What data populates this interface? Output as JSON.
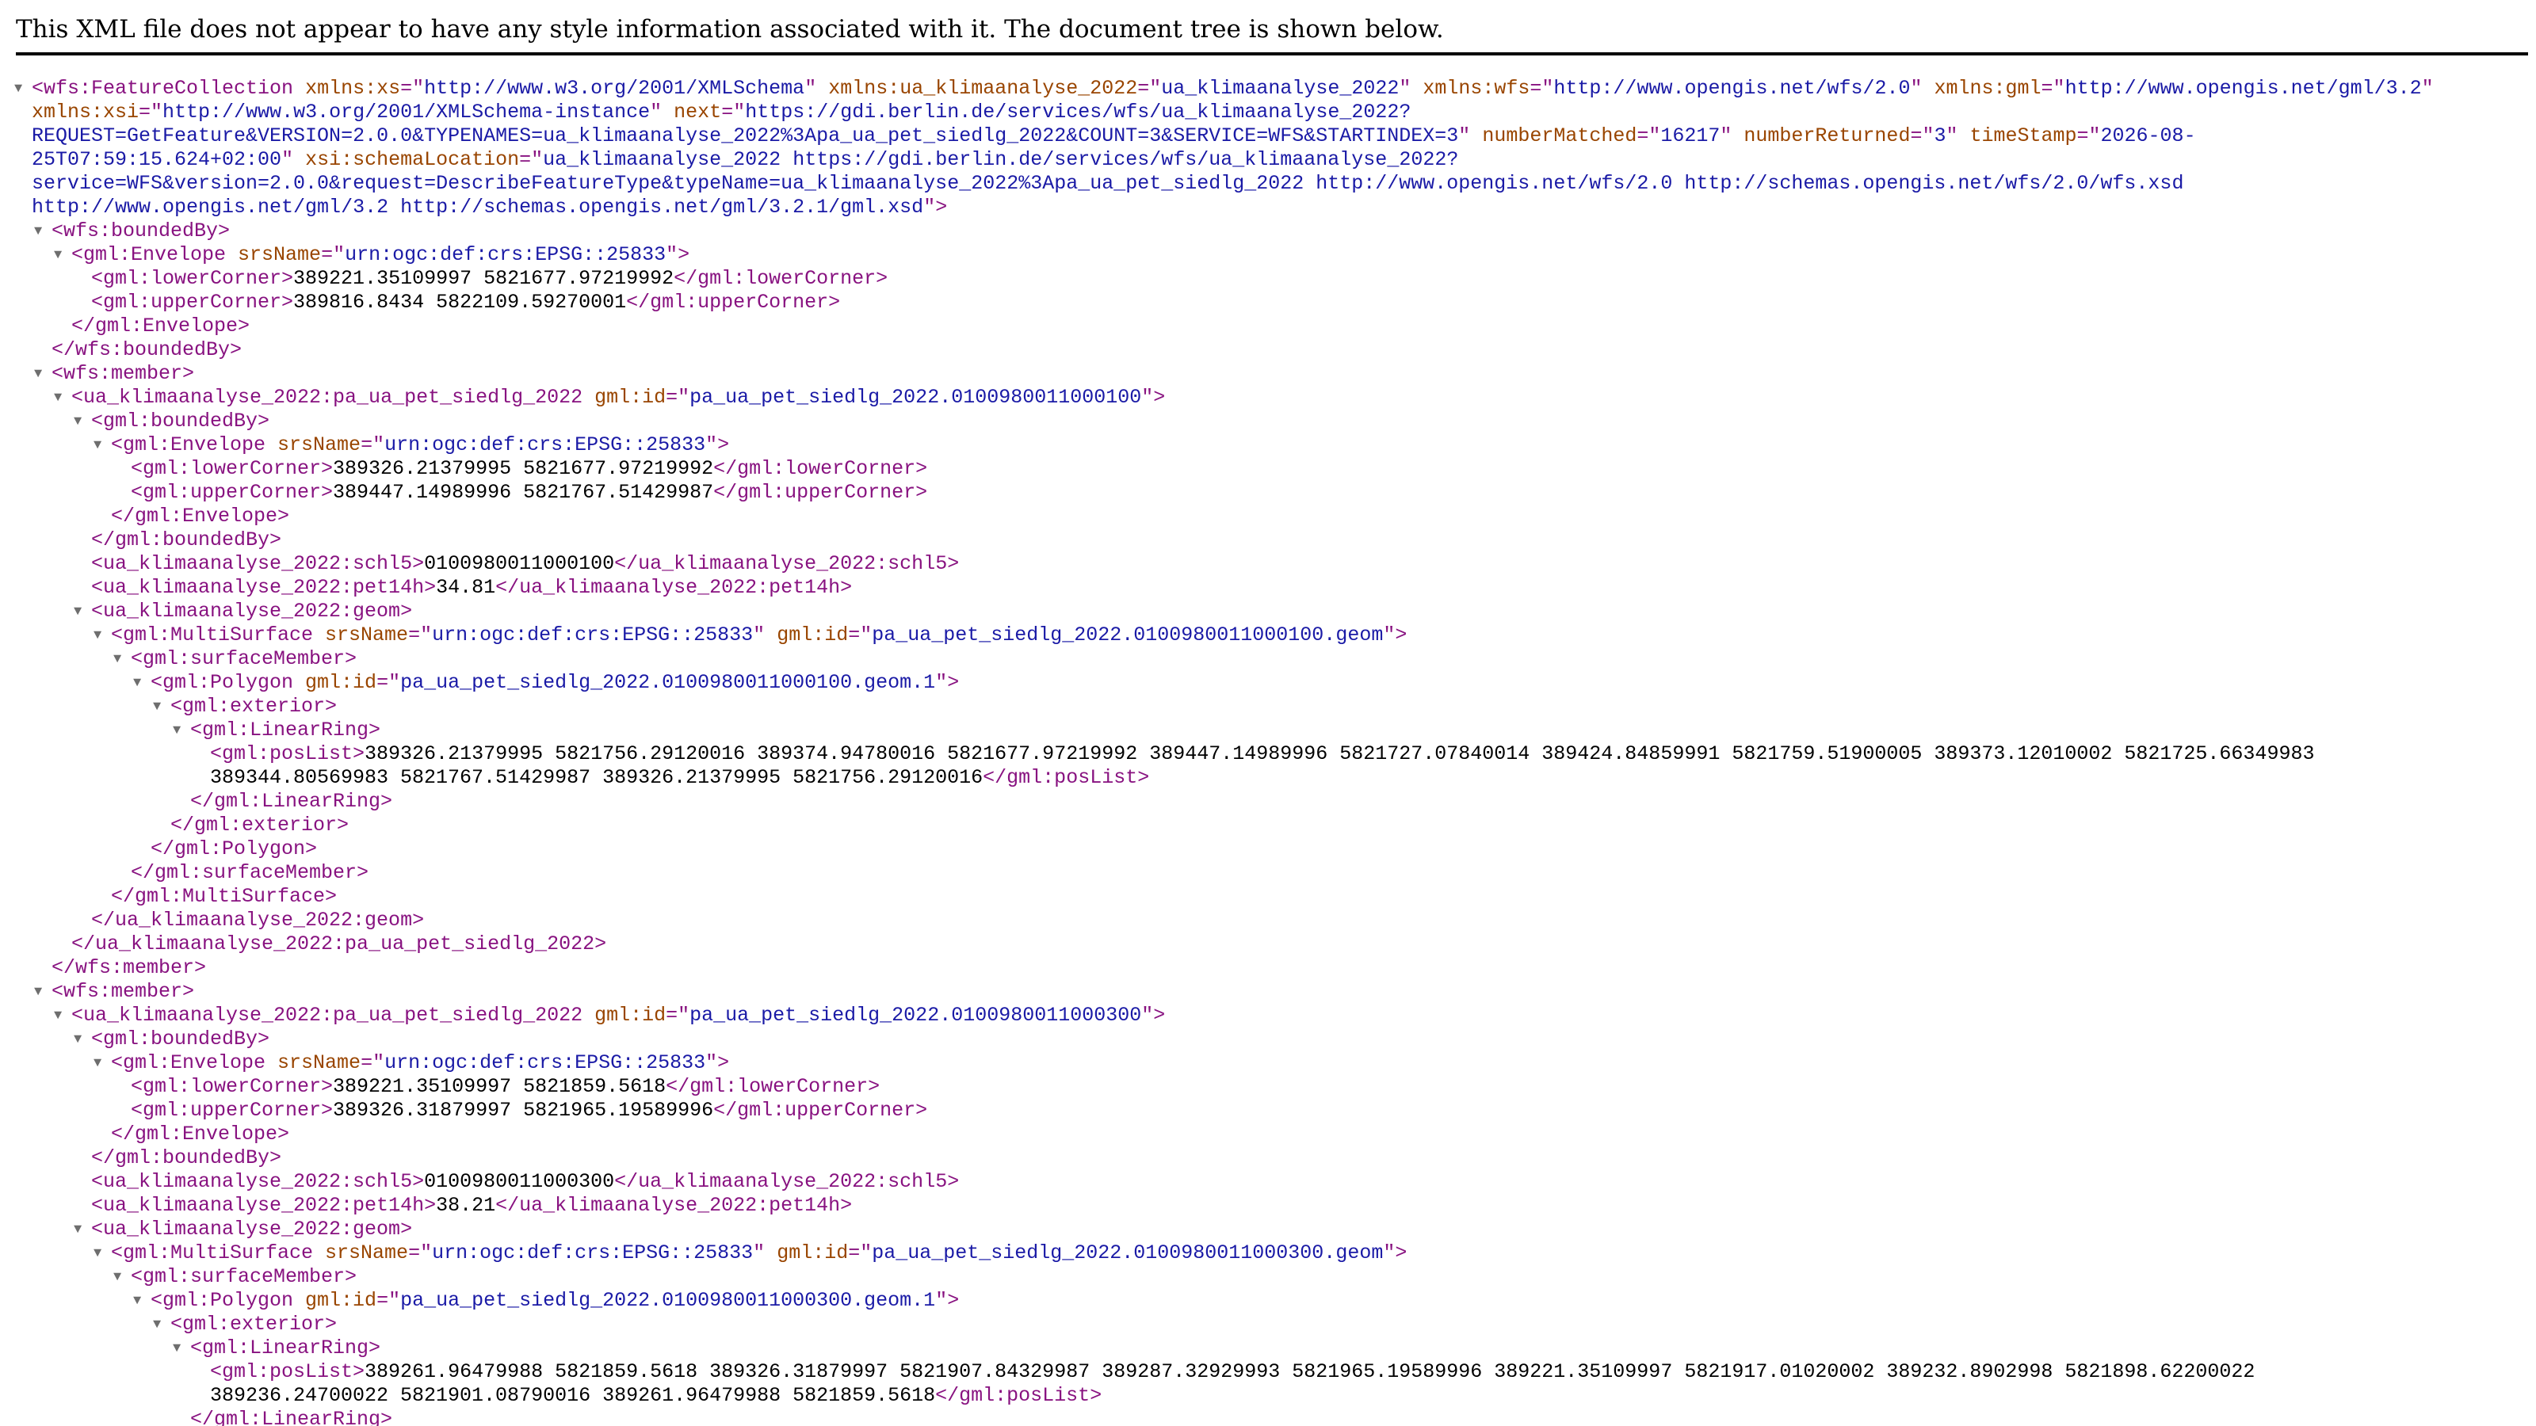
{
  "header": {
    "message": "This XML file does not appear to have any style information associated with it. The document tree is shown below."
  },
  "colors": {
    "tag": "#881280",
    "attribute_name": "#994500",
    "attribute_value": "#1a1aa6",
    "text": "#000000",
    "toggle": "#6e6e6e"
  },
  "toggle_icon": "triangle-down-icon",
  "xml_lines": [
    {
      "indent": 0,
      "toggle": true,
      "parts": [
        [
          "tag",
          "<wfs:FeatureCollection "
        ],
        [
          "an",
          "xmlns:xs"
        ],
        [
          "tag",
          "=\""
        ],
        [
          "av",
          "http://www.w3.org/2001/XMLSchema"
        ],
        [
          "tag",
          "\" "
        ],
        [
          "an",
          "xmlns:ua_klimaanalyse_2022"
        ],
        [
          "tag",
          "=\""
        ],
        [
          "av",
          "ua_klimaanalyse_2022"
        ],
        [
          "tag",
          "\" "
        ],
        [
          "an",
          "xmlns:wfs"
        ],
        [
          "tag",
          "=\""
        ],
        [
          "av",
          "http://www.opengis.net/wfs/2.0"
        ],
        [
          "tag",
          "\" "
        ],
        [
          "an",
          "xmlns:gml"
        ],
        [
          "tag",
          "=\""
        ],
        [
          "av",
          "http://www.opengis.net/gml/3.2"
        ],
        [
          "tag",
          "\""
        ]
      ]
    },
    {
      "indent": 0,
      "toggle": false,
      "parts": [
        [
          "an",
          "xmlns:xsi"
        ],
        [
          "tag",
          "=\""
        ],
        [
          "av",
          "http://www.w3.org/2001/XMLSchema-instance"
        ],
        [
          "tag",
          "\" "
        ],
        [
          "an",
          "next"
        ],
        [
          "tag",
          "=\""
        ],
        [
          "av",
          "https://gdi.berlin.de/services/wfs/ua_klimaanalyse_2022?"
        ]
      ]
    },
    {
      "indent": 0,
      "toggle": false,
      "parts": [
        [
          "av",
          "REQUEST=GetFeature&VERSION=2.0.0&TYPENAMES=ua_klimaanalyse_2022%3Apa_ua_pet_siedlg_2022&COUNT=3&SERVICE=WFS&STARTINDEX=3"
        ],
        [
          "tag",
          "\" "
        ],
        [
          "an",
          "numberMatched"
        ],
        [
          "tag",
          "=\""
        ],
        [
          "av",
          "16217"
        ],
        [
          "tag",
          "\" "
        ],
        [
          "an",
          "numberReturned"
        ],
        [
          "tag",
          "=\""
        ],
        [
          "av",
          "3"
        ],
        [
          "tag",
          "\" "
        ],
        [
          "an",
          "timeStamp"
        ],
        [
          "tag",
          "=\""
        ],
        [
          "av",
          "2026-08-"
        ]
      ]
    },
    {
      "indent": 0,
      "toggle": false,
      "parts": [
        [
          "av",
          "25T07:59:15.624+02:00"
        ],
        [
          "tag",
          "\" "
        ],
        [
          "an",
          "xsi:schemaLocation"
        ],
        [
          "tag",
          "=\""
        ],
        [
          "av",
          "ua_klimaanalyse_2022 https://gdi.berlin.de/services/wfs/ua_klimaanalyse_2022?"
        ]
      ]
    },
    {
      "indent": 0,
      "toggle": false,
      "parts": [
        [
          "av",
          "service=WFS&version=2.0.0&request=DescribeFeatureType&typeName=ua_klimaanalyse_2022%3Apa_ua_pet_siedlg_2022 http://www.opengis.net/wfs/2.0 http://schemas.opengis.net/wfs/2.0/wfs.xsd"
        ]
      ]
    },
    {
      "indent": 0,
      "toggle": false,
      "parts": [
        [
          "av",
          "http://www.opengis.net/gml/3.2 http://schemas.opengis.net/gml/3.2.1/gml.xsd"
        ],
        [
          "tag",
          "\">"
        ]
      ]
    },
    {
      "indent": 1,
      "toggle": true,
      "parts": [
        [
          "tag",
          "<wfs:boundedBy>"
        ]
      ]
    },
    {
      "indent": 2,
      "toggle": true,
      "parts": [
        [
          "tag",
          "<gml:Envelope "
        ],
        [
          "an",
          "srsName"
        ],
        [
          "tag",
          "=\""
        ],
        [
          "av",
          "urn:ogc:def:crs:EPSG::25833"
        ],
        [
          "tag",
          "\">"
        ]
      ]
    },
    {
      "indent": 3,
      "toggle": false,
      "parts": [
        [
          "tag",
          "<gml:lowerCorner>"
        ],
        [
          "tx",
          "389221.35109997 5821677.97219992"
        ],
        [
          "tag",
          "</gml:lowerCorner>"
        ]
      ]
    },
    {
      "indent": 3,
      "toggle": false,
      "parts": [
        [
          "tag",
          "<gml:upperCorner>"
        ],
        [
          "tx",
          "389816.8434 5822109.59270001"
        ],
        [
          "tag",
          "</gml:upperCorner>"
        ]
      ]
    },
    {
      "indent": 2,
      "toggle": false,
      "parts": [
        [
          "tag",
          "</gml:Envelope>"
        ]
      ]
    },
    {
      "indent": 1,
      "toggle": false,
      "parts": [
        [
          "tag",
          "</wfs:boundedBy>"
        ]
      ]
    },
    {
      "indent": 1,
      "toggle": true,
      "parts": [
        [
          "tag",
          "<wfs:member>"
        ]
      ]
    },
    {
      "indent": 2,
      "toggle": true,
      "parts": [
        [
          "tag",
          "<ua_klimaanalyse_2022:pa_ua_pet_siedlg_2022 "
        ],
        [
          "an",
          "gml:id"
        ],
        [
          "tag",
          "=\""
        ],
        [
          "av",
          "pa_ua_pet_siedlg_2022.0100980011000100"
        ],
        [
          "tag",
          "\">"
        ]
      ]
    },
    {
      "indent": 3,
      "toggle": true,
      "parts": [
        [
          "tag",
          "<gml:boundedBy>"
        ]
      ]
    },
    {
      "indent": 4,
      "toggle": true,
      "parts": [
        [
          "tag",
          "<gml:Envelope "
        ],
        [
          "an",
          "srsName"
        ],
        [
          "tag",
          "=\""
        ],
        [
          "av",
          "urn:ogc:def:crs:EPSG::25833"
        ],
        [
          "tag",
          "\">"
        ]
      ]
    },
    {
      "indent": 5,
      "toggle": false,
      "parts": [
        [
          "tag",
          "<gml:lowerCorner>"
        ],
        [
          "tx",
          "389326.21379995 5821677.97219992"
        ],
        [
          "tag",
          "</gml:lowerCorner>"
        ]
      ]
    },
    {
      "indent": 5,
      "toggle": false,
      "parts": [
        [
          "tag",
          "<gml:upperCorner>"
        ],
        [
          "tx",
          "389447.14989996 5821767.51429987"
        ],
        [
          "tag",
          "</gml:upperCorner>"
        ]
      ]
    },
    {
      "indent": 4,
      "toggle": false,
      "parts": [
        [
          "tag",
          "</gml:Envelope>"
        ]
      ]
    },
    {
      "indent": 3,
      "toggle": false,
      "parts": [
        [
          "tag",
          "</gml:boundedBy>"
        ]
      ]
    },
    {
      "indent": 3,
      "toggle": false,
      "parts": [
        [
          "tag",
          "<ua_klimaanalyse_2022:schl5>"
        ],
        [
          "tx",
          "0100980011000100"
        ],
        [
          "tag",
          "</ua_klimaanalyse_2022:schl5>"
        ]
      ]
    },
    {
      "indent": 3,
      "toggle": false,
      "parts": [
        [
          "tag",
          "<ua_klimaanalyse_2022:pet14h>"
        ],
        [
          "tx",
          "34.81"
        ],
        [
          "tag",
          "</ua_klimaanalyse_2022:pet14h>"
        ]
      ]
    },
    {
      "indent": 3,
      "toggle": true,
      "parts": [
        [
          "tag",
          "<ua_klimaanalyse_2022:geom>"
        ]
      ]
    },
    {
      "indent": 4,
      "toggle": true,
      "parts": [
        [
          "tag",
          "<gml:MultiSurface "
        ],
        [
          "an",
          "srsName"
        ],
        [
          "tag",
          "=\""
        ],
        [
          "av",
          "urn:ogc:def:crs:EPSG::25833"
        ],
        [
          "tag",
          "\" "
        ],
        [
          "an",
          "gml:id"
        ],
        [
          "tag",
          "=\""
        ],
        [
          "av",
          "pa_ua_pet_siedlg_2022.0100980011000100.geom"
        ],
        [
          "tag",
          "\">"
        ]
      ]
    },
    {
      "indent": 5,
      "toggle": true,
      "parts": [
        [
          "tag",
          "<gml:surfaceMember>"
        ]
      ]
    },
    {
      "indent": 6,
      "toggle": true,
      "parts": [
        [
          "tag",
          "<gml:Polygon "
        ],
        [
          "an",
          "gml:id"
        ],
        [
          "tag",
          "=\""
        ],
        [
          "av",
          "pa_ua_pet_siedlg_2022.0100980011000100.geom.1"
        ],
        [
          "tag",
          "\">"
        ]
      ]
    },
    {
      "indent": 7,
      "toggle": true,
      "parts": [
        [
          "tag",
          "<gml:exterior>"
        ]
      ]
    },
    {
      "indent": 8,
      "toggle": true,
      "parts": [
        [
          "tag",
          "<gml:LinearRing>"
        ]
      ]
    },
    {
      "indent": 9,
      "toggle": false,
      "parts": [
        [
          "tag",
          "<gml:posList>"
        ],
        [
          "tx",
          "389326.21379995 5821756.29120016 389374.94780016 5821677.97219992 389447.14989996 5821727.07840014 389424.84859991 5821759.51900005 389373.12010002 5821725.66349983"
        ]
      ]
    },
    {
      "indent": 9,
      "toggle": false,
      "parts": [
        [
          "tx",
          "389344.80569983 5821767.51429987 389326.21379995 5821756.29120016"
        ],
        [
          "tag",
          "</gml:posList>"
        ]
      ]
    },
    {
      "indent": 8,
      "toggle": false,
      "parts": [
        [
          "tag",
          "</gml:LinearRing>"
        ]
      ]
    },
    {
      "indent": 7,
      "toggle": false,
      "parts": [
        [
          "tag",
          "</gml:exterior>"
        ]
      ]
    },
    {
      "indent": 6,
      "toggle": false,
      "parts": [
        [
          "tag",
          "</gml:Polygon>"
        ]
      ]
    },
    {
      "indent": 5,
      "toggle": false,
      "parts": [
        [
          "tag",
          "</gml:surfaceMember>"
        ]
      ]
    },
    {
      "indent": 4,
      "toggle": false,
      "parts": [
        [
          "tag",
          "</gml:MultiSurface>"
        ]
      ]
    },
    {
      "indent": 3,
      "toggle": false,
      "parts": [
        [
          "tag",
          "</ua_klimaanalyse_2022:geom>"
        ]
      ]
    },
    {
      "indent": 2,
      "toggle": false,
      "parts": [
        [
          "tag",
          "</ua_klimaanalyse_2022:pa_ua_pet_siedlg_2022>"
        ]
      ]
    },
    {
      "indent": 1,
      "toggle": false,
      "parts": [
        [
          "tag",
          "</wfs:member>"
        ]
      ]
    },
    {
      "indent": 1,
      "toggle": true,
      "parts": [
        [
          "tag",
          "<wfs:member>"
        ]
      ]
    },
    {
      "indent": 2,
      "toggle": true,
      "parts": [
        [
          "tag",
          "<ua_klimaanalyse_2022:pa_ua_pet_siedlg_2022 "
        ],
        [
          "an",
          "gml:id"
        ],
        [
          "tag",
          "=\""
        ],
        [
          "av",
          "pa_ua_pet_siedlg_2022.0100980011000300"
        ],
        [
          "tag",
          "\">"
        ]
      ]
    },
    {
      "indent": 3,
      "toggle": true,
      "parts": [
        [
          "tag",
          "<gml:boundedBy>"
        ]
      ]
    },
    {
      "indent": 4,
      "toggle": true,
      "parts": [
        [
          "tag",
          "<gml:Envelope "
        ],
        [
          "an",
          "srsName"
        ],
        [
          "tag",
          "=\""
        ],
        [
          "av",
          "urn:ogc:def:crs:EPSG::25833"
        ],
        [
          "tag",
          "\">"
        ]
      ]
    },
    {
      "indent": 5,
      "toggle": false,
      "parts": [
        [
          "tag",
          "<gml:lowerCorner>"
        ],
        [
          "tx",
          "389221.35109997 5821859.5618"
        ],
        [
          "tag",
          "</gml:lowerCorner>"
        ]
      ]
    },
    {
      "indent": 5,
      "toggle": false,
      "parts": [
        [
          "tag",
          "<gml:upperCorner>"
        ],
        [
          "tx",
          "389326.31879997 5821965.19589996"
        ],
        [
          "tag",
          "</gml:upperCorner>"
        ]
      ]
    },
    {
      "indent": 4,
      "toggle": false,
      "parts": [
        [
          "tag",
          "</gml:Envelope>"
        ]
      ]
    },
    {
      "indent": 3,
      "toggle": false,
      "parts": [
        [
          "tag",
          "</gml:boundedBy>"
        ]
      ]
    },
    {
      "indent": 3,
      "toggle": false,
      "parts": [
        [
          "tag",
          "<ua_klimaanalyse_2022:schl5>"
        ],
        [
          "tx",
          "0100980011000300"
        ],
        [
          "tag",
          "</ua_klimaanalyse_2022:schl5>"
        ]
      ]
    },
    {
      "indent": 3,
      "toggle": false,
      "parts": [
        [
          "tag",
          "<ua_klimaanalyse_2022:pet14h>"
        ],
        [
          "tx",
          "38.21"
        ],
        [
          "tag",
          "</ua_klimaanalyse_2022:pet14h>"
        ]
      ]
    },
    {
      "indent": 3,
      "toggle": true,
      "parts": [
        [
          "tag",
          "<ua_klimaanalyse_2022:geom>"
        ]
      ]
    },
    {
      "indent": 4,
      "toggle": true,
      "parts": [
        [
          "tag",
          "<gml:MultiSurface "
        ],
        [
          "an",
          "srsName"
        ],
        [
          "tag",
          "=\""
        ],
        [
          "av",
          "urn:ogc:def:crs:EPSG::25833"
        ],
        [
          "tag",
          "\" "
        ],
        [
          "an",
          "gml:id"
        ],
        [
          "tag",
          "=\""
        ],
        [
          "av",
          "pa_ua_pet_siedlg_2022.0100980011000300.geom"
        ],
        [
          "tag",
          "\">"
        ]
      ]
    },
    {
      "indent": 5,
      "toggle": true,
      "parts": [
        [
          "tag",
          "<gml:surfaceMember>"
        ]
      ]
    },
    {
      "indent": 6,
      "toggle": true,
      "parts": [
        [
          "tag",
          "<gml:Polygon "
        ],
        [
          "an",
          "gml:id"
        ],
        [
          "tag",
          "=\""
        ],
        [
          "av",
          "pa_ua_pet_siedlg_2022.0100980011000300.geom.1"
        ],
        [
          "tag",
          "\">"
        ]
      ]
    },
    {
      "indent": 7,
      "toggle": true,
      "parts": [
        [
          "tag",
          "<gml:exterior>"
        ]
      ]
    },
    {
      "indent": 8,
      "toggle": true,
      "parts": [
        [
          "tag",
          "<gml:LinearRing>"
        ]
      ]
    },
    {
      "indent": 9,
      "toggle": false,
      "parts": [
        [
          "tag",
          "<gml:posList>"
        ],
        [
          "tx",
          "389261.96479988 5821859.5618 389326.31879997 5821907.84329987 389287.32929993 5821965.19589996 389221.35109997 5821917.01020002 389232.8902998 5821898.62200022"
        ]
      ]
    },
    {
      "indent": 9,
      "toggle": false,
      "parts": [
        [
          "tx",
          "389236.24700022 5821901.08790016 389261.96479988 5821859.5618"
        ],
        [
          "tag",
          "</gml:posList>"
        ]
      ]
    },
    {
      "indent": 8,
      "toggle": false,
      "parts": [
        [
          "tag",
          "</gml:LinearRing>"
        ]
      ]
    }
  ]
}
